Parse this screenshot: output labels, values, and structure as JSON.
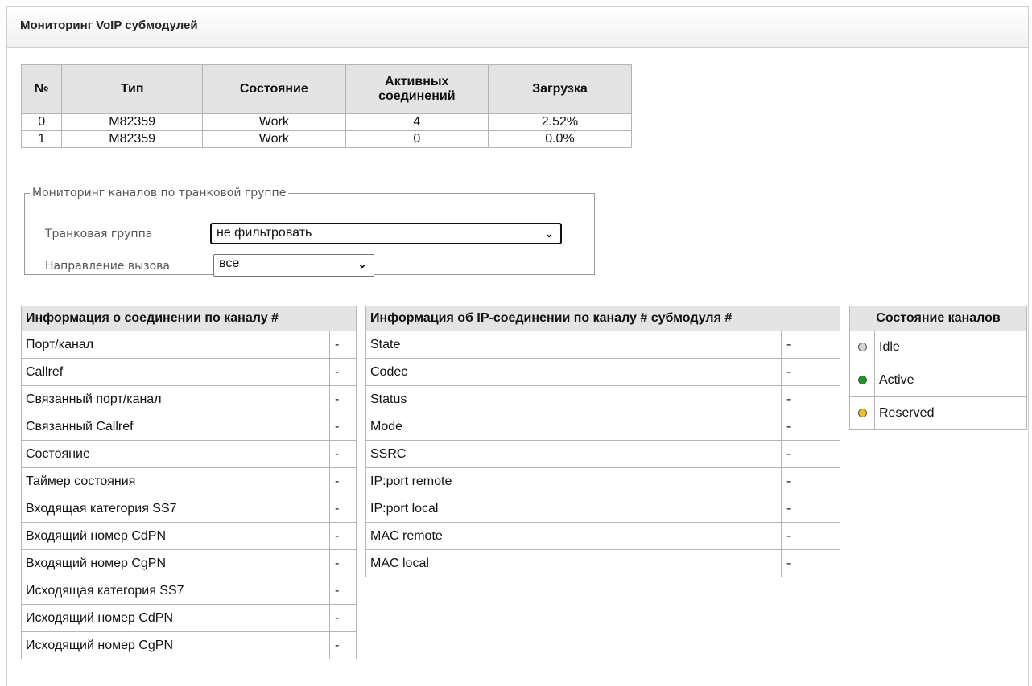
{
  "page": {
    "title": "Мониторинг VoIP субмодулей"
  },
  "submodules": {
    "headers": [
      "№",
      "Тип",
      "Состояние",
      "Активных соединений",
      "Загрузка"
    ],
    "rows": [
      {
        "no": "0",
        "type": "M82359",
        "state": "Work",
        "active": "4",
        "load": "2.52%"
      },
      {
        "no": "1",
        "type": "M82359",
        "state": "Work",
        "active": "0",
        "load": "0.0%"
      }
    ]
  },
  "filter": {
    "legend": "Мониторинг каналов по транковой группе",
    "trunk_label": "Транковая группа",
    "trunk_value": "не фильтровать",
    "direction_label": "Направление вызова",
    "direction_value": "все"
  },
  "connection_info": {
    "title": "Информация о соединении по каналу #",
    "rows": [
      {
        "label": "Порт/канал",
        "value": "-"
      },
      {
        "label": "Callref",
        "value": "-"
      },
      {
        "label": "Связанный порт/канал",
        "value": "-"
      },
      {
        "label": "Связанный Callref",
        "value": "-"
      },
      {
        "label": "Состояние",
        "value": "-"
      },
      {
        "label": "Таймер состояния",
        "value": "-"
      },
      {
        "label": "Входящая категория SS7",
        "value": "-"
      },
      {
        "label": "Входящий номер CdPN",
        "value": "-"
      },
      {
        "label": "Входящий номер CgPN",
        "value": "-"
      },
      {
        "label": "Исходящая категория SS7",
        "value": "-"
      },
      {
        "label": "Исходящий номер CdPN",
        "value": "-"
      },
      {
        "label": "Исходящий номер CgPN",
        "value": "-"
      }
    ]
  },
  "ip_info": {
    "title": "Информация об IP-соединении по каналу # субмодуля #",
    "rows": [
      {
        "label": "State",
        "value": "-"
      },
      {
        "label": "Codec",
        "value": "-"
      },
      {
        "label": "Status",
        "value": "-"
      },
      {
        "label": "Mode",
        "value": "-"
      },
      {
        "label": "SSRC",
        "value": "-"
      },
      {
        "label": "IP:port remote",
        "value": "-"
      },
      {
        "label": "IP:port local",
        "value": "-"
      },
      {
        "label": "MAC remote",
        "value": "-"
      },
      {
        "label": "MAC local",
        "value": "-"
      }
    ]
  },
  "channel_states": {
    "title": "Состояние каналов",
    "items": [
      {
        "label": "Idle",
        "color": "#d6d6d6",
        "icon": "idle-status-dot-icon"
      },
      {
        "label": "Active",
        "color": "#1a9a1a",
        "icon": "active-status-dot-icon"
      },
      {
        "label": "Reserved",
        "color": "#f0c020",
        "icon": "reserved-status-dot-icon"
      }
    ]
  }
}
